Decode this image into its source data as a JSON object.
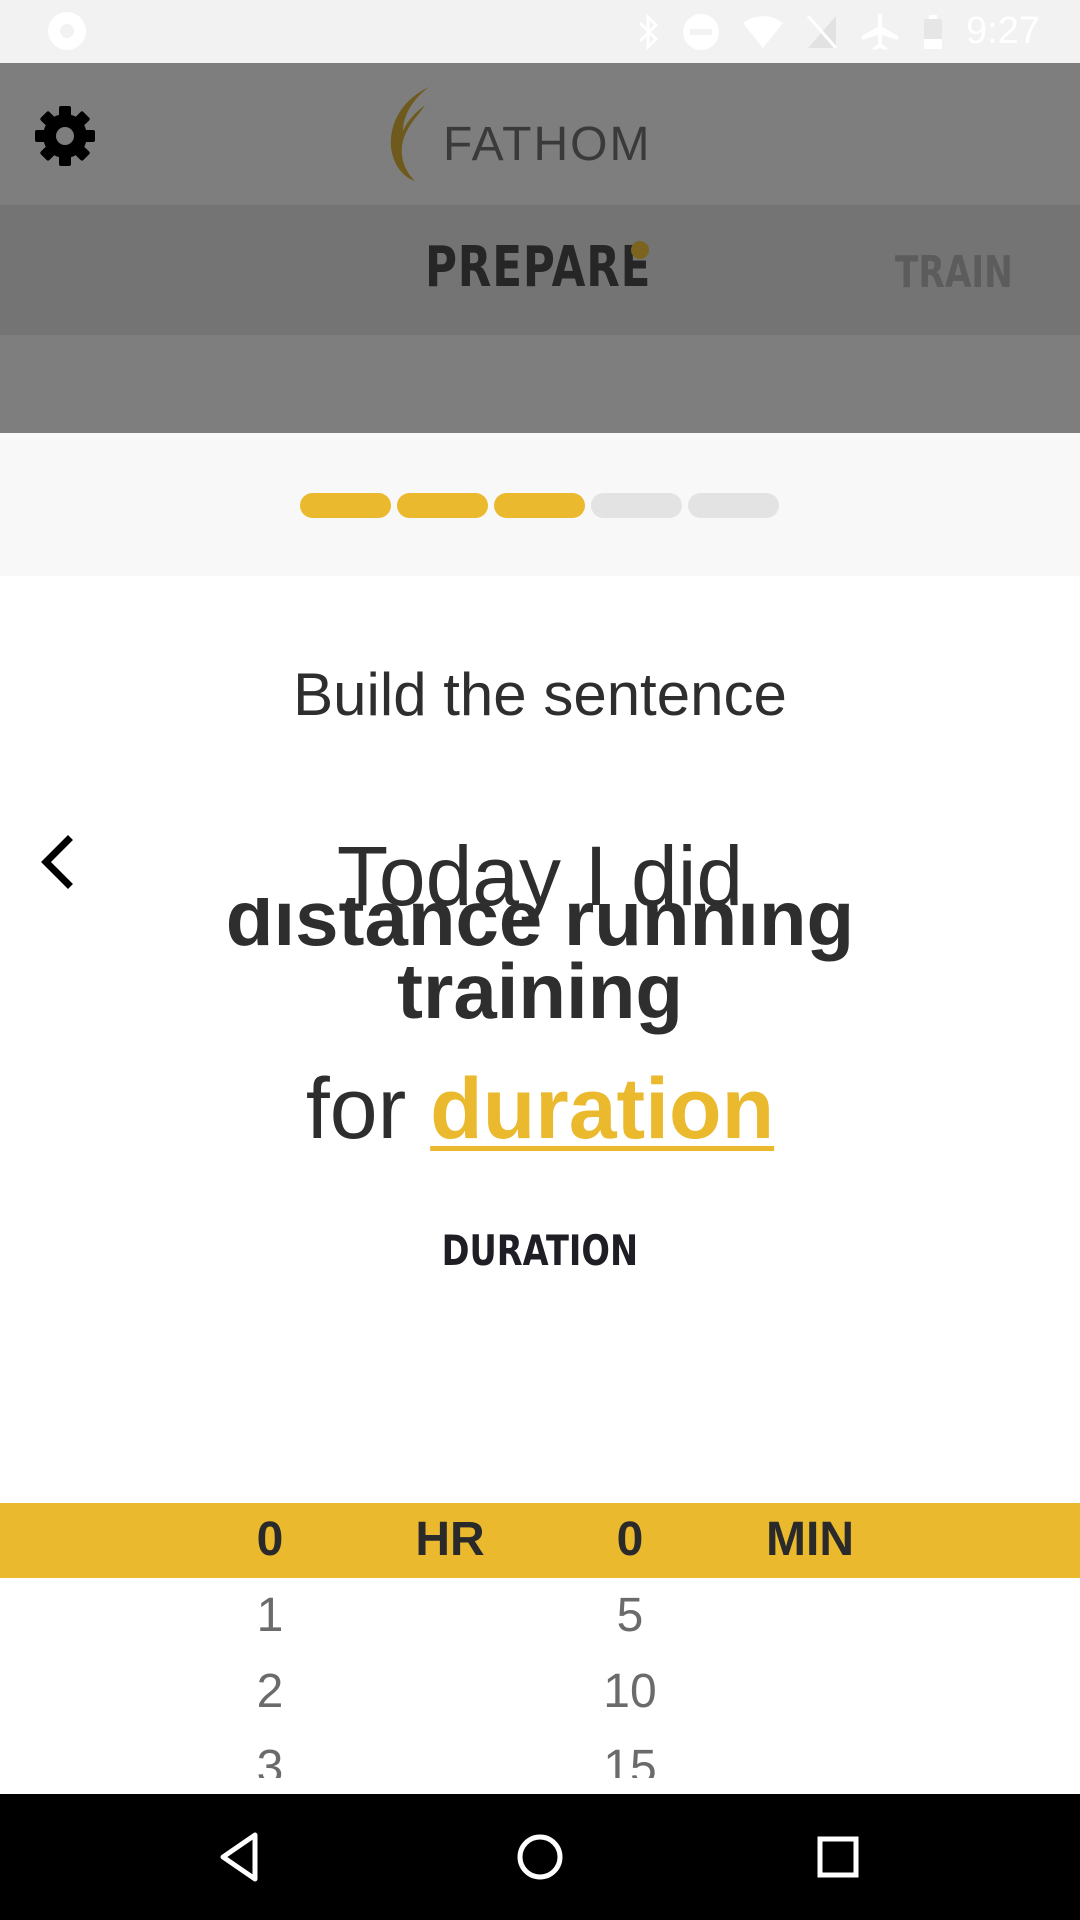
{
  "status_bar": {
    "time": "9:27",
    "icons": [
      "app-notification-icon",
      "bluetooth-icon",
      "do-not-disturb-icon",
      "wifi-icon",
      "no-sim-icon",
      "airplane-mode-icon",
      "battery-icon"
    ]
  },
  "header": {
    "logo_text": "FATHOM",
    "tabs": [
      {
        "label": "PREPARE",
        "active": true
      },
      {
        "label": "TRAIN",
        "active": false
      }
    ]
  },
  "progress": {
    "total_steps": 5,
    "completed_steps": 3
  },
  "main": {
    "prompt": "Build the sentence",
    "sentence": {
      "line1": "Today I did",
      "activity_line1": "distance running",
      "activity_line2": "training",
      "for_word": "for",
      "duration_link": "duration"
    },
    "picker_title": "DURATION"
  },
  "picker": {
    "hours": {
      "selected": "0",
      "unit": "HR",
      "options": [
        "1",
        "2",
        "3"
      ]
    },
    "minutes": {
      "selected": "0",
      "unit": "MIN",
      "options": [
        "5",
        "10",
        "15"
      ]
    }
  },
  "colors": {
    "accent": "#ebb92e",
    "header_overlay": "#7e7e7e",
    "text_dark": "#2e2e2e"
  }
}
